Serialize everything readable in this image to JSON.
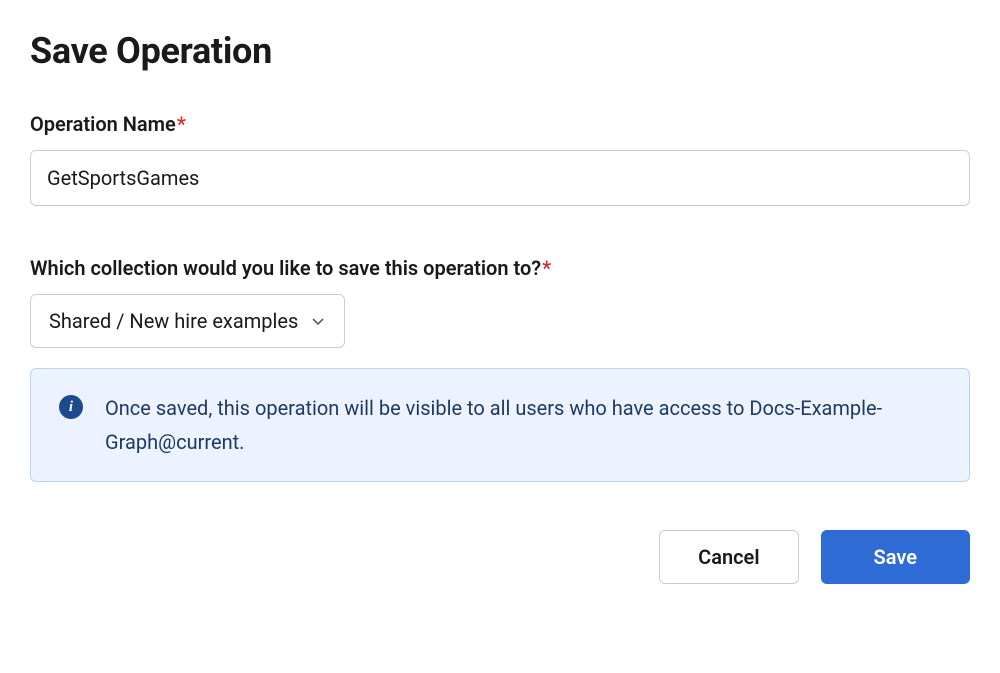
{
  "title": "Save Operation",
  "fields": {
    "operationName": {
      "label": "Operation Name",
      "required": true,
      "value": "GetSportsGames"
    },
    "collection": {
      "label": "Which collection would you like to save this operation to?",
      "required": true,
      "selected": "Shared / New hire examples"
    }
  },
  "infoBanner": {
    "text": "Once saved, this operation will be visible to all users who have access to Docs-Example-Graph@current."
  },
  "buttons": {
    "cancel": "Cancel",
    "save": "Save"
  },
  "requiredMark": "*"
}
